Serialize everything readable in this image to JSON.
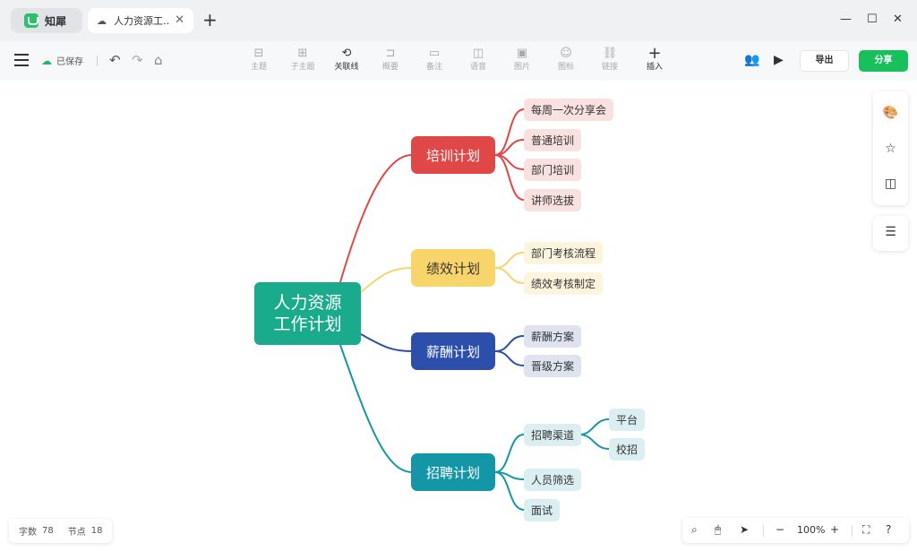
{
  "app": {
    "name": "知犀"
  },
  "tab": {
    "title": "人力资源工…",
    "close": "✕"
  },
  "window": {
    "new_tab": "+",
    "minimize": "—",
    "maximize": "☐",
    "close": "✕"
  },
  "toolbar": {
    "save_status": "已保存",
    "tools": [
      {
        "label": "主题",
        "icon": "⊟"
      },
      {
        "label": "子主题",
        "icon": "⊞"
      },
      {
        "label": "关联线",
        "icon": "⟲"
      },
      {
        "label": "概要",
        "icon": "⊐"
      },
      {
        "label": "备注",
        "icon": "▭"
      },
      {
        "label": "语音",
        "icon": "◫"
      },
      {
        "label": "图片",
        "icon": "▣"
      },
      {
        "label": "图标",
        "icon": "☺"
      },
      {
        "label": "链接",
        "icon": "⛓"
      },
      {
        "label": "插入",
        "icon": "+"
      }
    ],
    "export_label": "导出",
    "share_label": "分享"
  },
  "mindmap": {
    "central": {
      "line1": "人力资源",
      "line2": "工作计划",
      "color": "#1aaa8c"
    },
    "branches": [
      {
        "label": "培训计划",
        "color": "#e04848",
        "children": [
          "每周一次分享会",
          "普通培训",
          "部门培训",
          "讲师选拔"
        ]
      },
      {
        "label": "绩效计划",
        "color": "#f8d56b",
        "children": [
          "部门考核流程",
          "绩效考核制定"
        ]
      },
      {
        "label": "薪酬计划",
        "color": "#2b4faa",
        "children": [
          "薪酬方案",
          "晋级方案"
        ]
      },
      {
        "label": "招聘计划",
        "color": "#1496a6",
        "children": [
          "招聘渠道",
          "人员筛选",
          "面试"
        ],
        "grandchildren": [
          "平台",
          "校招"
        ]
      }
    ]
  },
  "stats": {
    "words_label": "字数",
    "words": "78",
    "nodes_label": "节点",
    "nodes": "18"
  },
  "zoom": {
    "level": "100%",
    "minus": "−",
    "plus": "+"
  }
}
